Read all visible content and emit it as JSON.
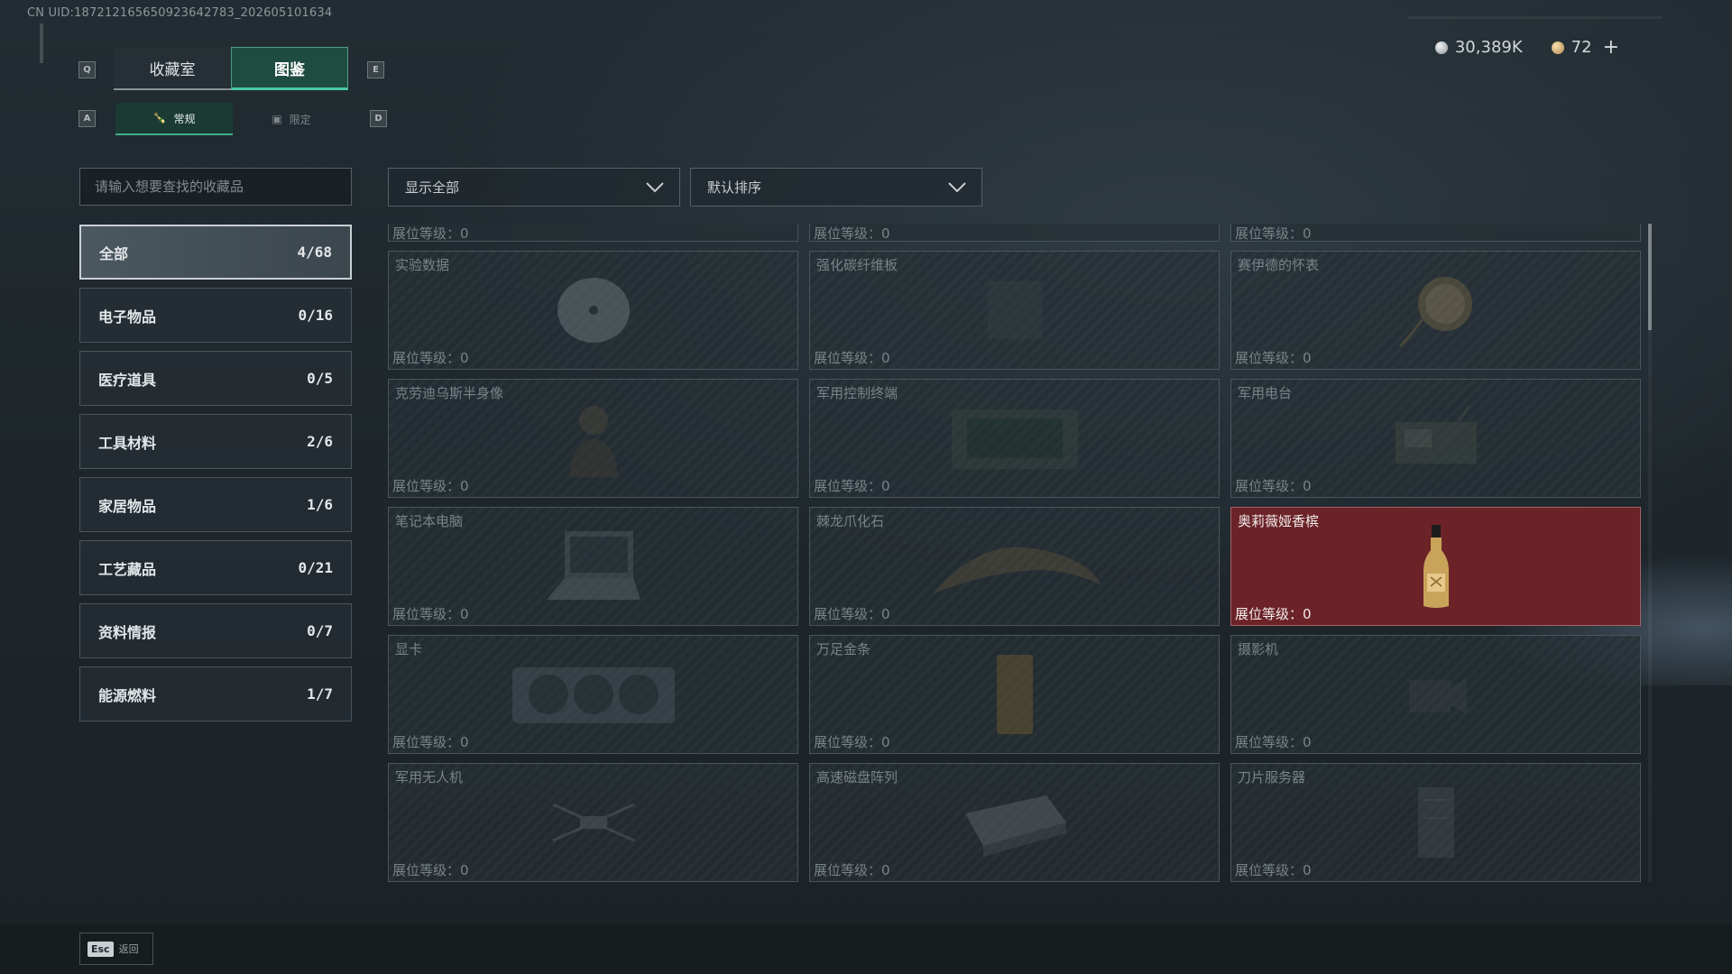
{
  "uid_text": "CN UID:187212165650923642783_202605101634",
  "keys": {
    "q": "Q",
    "e": "E",
    "a": "A",
    "d": "D"
  },
  "tabs": [
    {
      "label": "收藏室"
    },
    {
      "label": "图鉴"
    }
  ],
  "subtabs": [
    {
      "label": "常规"
    },
    {
      "label": "限定"
    }
  ],
  "wallet": {
    "silver": "30,389K",
    "gold": "72"
  },
  "search": {
    "placeholder": "请输入想要查找的收藏品"
  },
  "filter": {
    "selected": "显示全部"
  },
  "sort": {
    "selected": "默认排序"
  },
  "categories": [
    {
      "label": "全部",
      "count": "4/68"
    },
    {
      "label": "电子物品",
      "count": "0/16"
    },
    {
      "label": "医疗道具",
      "count": "0/5"
    },
    {
      "label": "工具材料",
      "count": "2/6"
    },
    {
      "label": "家居物品",
      "count": "1/6"
    },
    {
      "label": "工艺藏品",
      "count": "0/21"
    },
    {
      "label": "资料情报",
      "count": "0/7"
    },
    {
      "label": "能源燃料",
      "count": "1/7"
    }
  ],
  "level_label": "展位等级：0",
  "items": [
    {
      "name": "实验数据",
      "icon": "disc-icon"
    },
    {
      "name": "强化碳纤维板",
      "icon": "panel-icon"
    },
    {
      "name": "赛伊德的怀表",
      "icon": "pocket-watch-icon"
    },
    {
      "name": "克劳迪乌斯半身像",
      "icon": "bust-icon"
    },
    {
      "name": "军用控制终端",
      "icon": "terminal-icon"
    },
    {
      "name": "军用电台",
      "icon": "radio-icon"
    },
    {
      "name": "笔记本电脑",
      "icon": "laptop-icon"
    },
    {
      "name": "棘龙爪化石",
      "icon": "fossil-claw-icon"
    },
    {
      "name": "奥莉薇娅香槟",
      "icon": "champagne-bottle-icon"
    },
    {
      "name": "显卡",
      "icon": "graphics-card-icon"
    },
    {
      "name": "万足金条",
      "icon": "gold-bar-icon"
    },
    {
      "name": "摄影机",
      "icon": "camera-icon"
    },
    {
      "name": "军用无人机",
      "icon": "drone-icon"
    },
    {
      "name": "高速磁盘阵列",
      "icon": "disk-array-icon"
    },
    {
      "name": "刀片服务器",
      "icon": "blade-server-icon"
    }
  ],
  "footer": {
    "esc": "Esc",
    "back": "返回"
  }
}
